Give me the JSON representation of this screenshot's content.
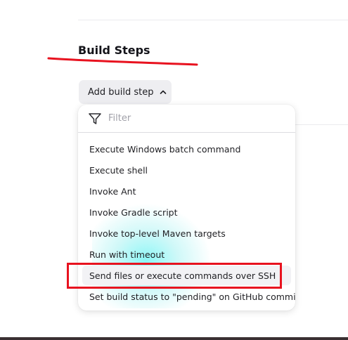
{
  "section": {
    "title": "Build Steps"
  },
  "add_button": {
    "label": "Add build step",
    "icon": "chevron-up-icon"
  },
  "dropdown": {
    "filter_placeholder": "Filter",
    "filter_value": "",
    "filter_icon": "filter-icon",
    "items": [
      {
        "label": "Execute Windows batch command"
      },
      {
        "label": "Execute shell"
      },
      {
        "label": "Invoke Ant"
      },
      {
        "label": "Invoke Gradle script"
      },
      {
        "label": "Invoke top-level Maven targets"
      },
      {
        "label": "Run with timeout"
      },
      {
        "label": "Send files or execute commands over SSH"
      },
      {
        "label": "Set build status to \"pending\" on GitHub commit"
      }
    ],
    "highlighted_item": "Send files or execute commands over SSH"
  },
  "annotations": {
    "color": "#e8121f"
  }
}
